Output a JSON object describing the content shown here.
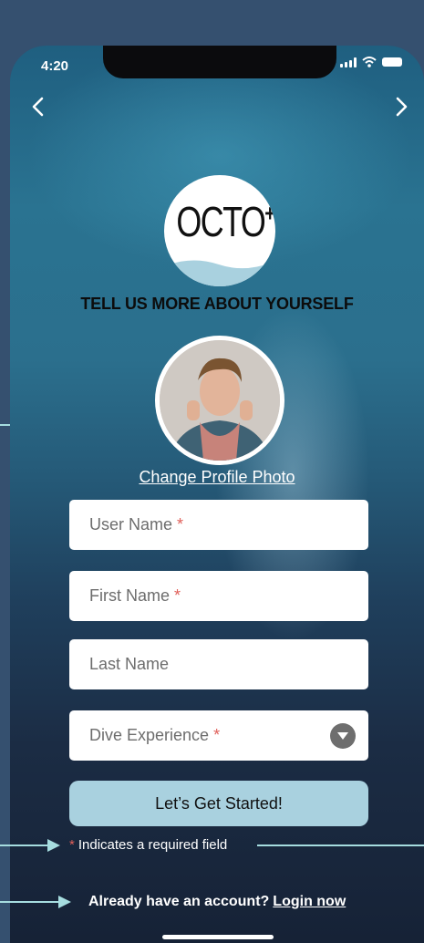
{
  "status_bar": {
    "time": "4:20"
  },
  "logo": {
    "text": "OCTO",
    "plus": "+"
  },
  "heading": "TELL US MORE ABOUT YOURSELF",
  "profile": {
    "change_photo_label": "Change Profile Photo"
  },
  "form": {
    "fields": [
      {
        "placeholder": "User Name",
        "required_mark": "*"
      },
      {
        "placeholder": "First Name",
        "required_mark": "*"
      },
      {
        "placeholder": "Last Name",
        "required_mark": ""
      },
      {
        "placeholder": "Dive Experience",
        "required_mark": "*"
      }
    ],
    "submit_label": "Let’s Get Started!"
  },
  "required_note": {
    "mark": "*",
    "text": "Indicates a required field"
  },
  "login": {
    "prompt": "Already have an account?",
    "link": "Login now"
  },
  "colors": {
    "background": "#35506f",
    "button": "#a9d1df",
    "required": "#e0605a",
    "guide_line": "#a6dde0"
  },
  "icons": [
    "back-icon",
    "forward-icon",
    "signal-icon",
    "wifi-icon",
    "battery-icon",
    "dropdown-chevron-icon"
  ]
}
